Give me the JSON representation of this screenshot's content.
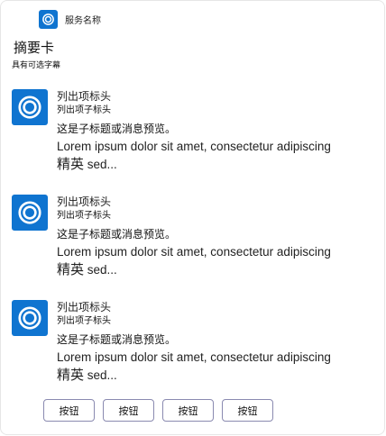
{
  "header": {
    "service_icon": "app-ring-icon",
    "service_name": "服务名称",
    "title": "摘要卡",
    "subtitle": "具有可选字幕"
  },
  "items": [
    {
      "icon": "app-ring-icon",
      "heading": "列出项标头",
      "subheading": "列出项子标头",
      "preview": "这是子标题或消息预览。",
      "body_line1": "Lorem ipsum dolor sit amet, consectetur adipiscing",
      "body_line2_cn": "精英",
      "body_line2_en": " sed..."
    },
    {
      "icon": "app-ring-icon",
      "heading": "列出项标头",
      "subheading": "列出项子标头",
      "preview": "这是子标题或消息预览。",
      "body_line1": "Lorem ipsum dolor sit amet, consectetur adipiscing",
      "body_line2_cn": "精英",
      "body_line2_en": " sed..."
    },
    {
      "icon": "app-ring-icon",
      "heading": "列出项标头",
      "subheading": "列出项子标头",
      "preview": "这是子标题或消息预览。",
      "body_line1": "Lorem ipsum dolor sit amet, consectetur adipiscing",
      "body_line2_cn": "精英",
      "body_line2_en": " sed..."
    }
  ],
  "buttons": [
    {
      "label": "按钮"
    },
    {
      "label": "按钮"
    },
    {
      "label": "按钮"
    },
    {
      "label": "按钮"
    }
  ],
  "colors": {
    "icon_background": "#0f74d0",
    "button_border": "#8a8ab0",
    "card_border": "#e6e6e6"
  }
}
